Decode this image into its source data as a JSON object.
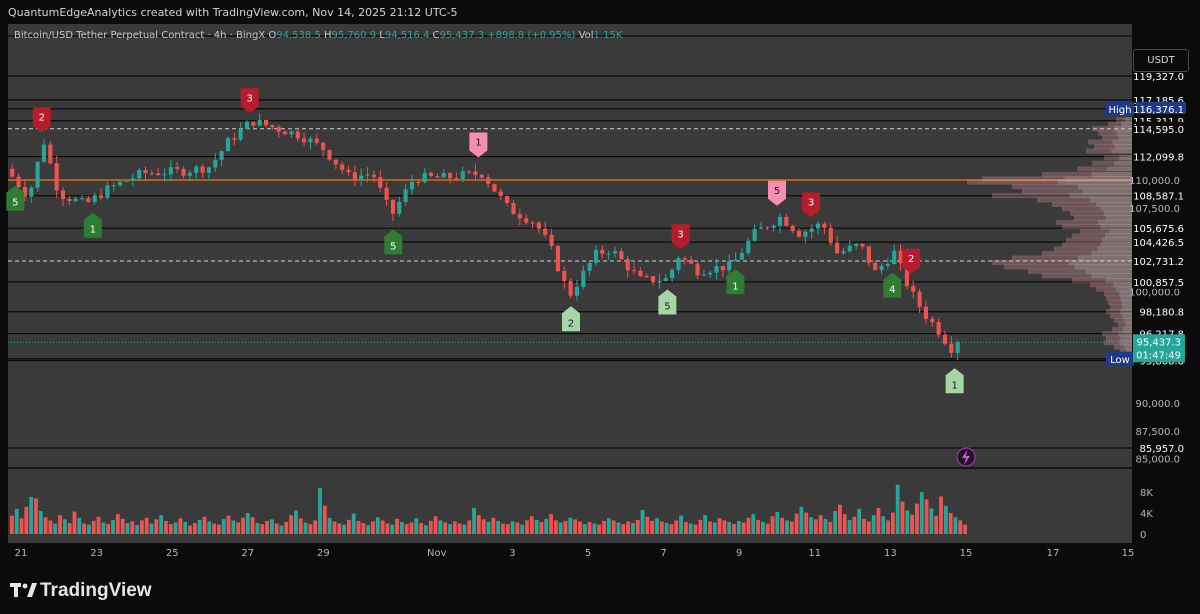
{
  "header": {
    "attribution": "QuantumEdgeAnalytics created with TradingView.com, Nov 14, 2025 21:12 UTC-5"
  },
  "legend": {
    "symbol": "Bitcoin/USD Tether Perpetual Contract · 4h · BingX",
    "o_label": "O",
    "o": "94,538.5",
    "h_label": "H",
    "h": "95,760.9",
    "l_label": "L",
    "l": "94,516.4",
    "c_label": "C",
    "c": "95,437.3",
    "change": "+898.8 (+0.95%)",
    "vol_label": "Vol",
    "vol": "1.15K"
  },
  "currency_button": "USDT",
  "footer": {
    "brand": "TradingView"
  },
  "colors": {
    "up": "#26a69a",
    "down": "#ef5350",
    "orange_line": "#f57c00",
    "bg_plot": "#3a3a3a",
    "page_bg": "#0b0b0b",
    "sell_marker": "#b71c2c",
    "sell_marker_light": "#f48fb1",
    "buy_marker": "#2e7d32",
    "buy_marker_light": "#a5d6a7"
  },
  "chart_data": {
    "type": "candlestick",
    "interval": "4h",
    "exchange": "BingX",
    "y_axis_ticks": [
      "110,000.0",
      "107,500.0",
      "100,000.0",
      "90,000.0",
      "87,500.0",
      "85,000.0"
    ],
    "price_levels": [
      {
        "label": "119,327.0",
        "value": 119327.0
      },
      {
        "label": "117,185.6",
        "value": 117185.6
      },
      {
        "label": "116,376.1",
        "value": 116376.1,
        "tag": "High"
      },
      {
        "label": "115,311.9",
        "value": 115311.9
      },
      {
        "label": "114,595.0",
        "value": 114595.0
      },
      {
        "label": "112,099.8",
        "value": 112099.8
      },
      {
        "label": "108,587.1",
        "value": 108587.1
      },
      {
        "label": "105,675.6",
        "value": 105675.6
      },
      {
        "label": "104,426.5",
        "value": 104426.5
      },
      {
        "label": "102,731.2",
        "value": 102731.2
      },
      {
        "label": "100,857.5",
        "value": 100857.5
      },
      {
        "label": "98,180.8",
        "value": 98180.8
      },
      {
        "label": "96,217.8",
        "value": 96217.8
      },
      {
        "label": "93,955.0",
        "value": 93955.0,
        "tag": "Low"
      },
      {
        "label": "93,808.8",
        "value": 93808.8
      },
      {
        "label": "85,957.0",
        "value": 85957.0
      }
    ],
    "current_price": {
      "label": "95,437.3",
      "countdown": "01:47:49",
      "value": 95437.3
    },
    "orange_level": 110000,
    "volume_ticks": [
      "8K",
      "4K",
      "0"
    ],
    "x_ticks": [
      {
        "label": "21",
        "day": 21
      },
      {
        "label": "23",
        "day": 23
      },
      {
        "label": "25",
        "day": 25
      },
      {
        "label": "27",
        "day": 27
      },
      {
        "label": "29",
        "day": 29
      },
      {
        "label": "Nov",
        "day": 32
      },
      {
        "label": "3",
        "day": 34
      },
      {
        "label": "5",
        "day": 36
      },
      {
        "label": "7",
        "day": 38
      },
      {
        "label": "9",
        "day": 40
      },
      {
        "label": "11",
        "day": 42
      },
      {
        "label": "13",
        "day": 44
      },
      {
        "label": "15",
        "day": 46
      },
      {
        "label": "17",
        "day": 48
      },
      {
        "label": "15",
        "day": 50
      }
    ],
    "anchors": [
      {
        "day": 20.6,
        "price": 111000
      },
      {
        "day": 21.2,
        "price": 108500
      },
      {
        "day": 21.6,
        "price": 113500
      },
      {
        "day": 22.0,
        "price": 108800
      },
      {
        "day": 22.7,
        "price": 107800
      },
      {
        "day": 23.3,
        "price": 109200
      },
      {
        "day": 24.2,
        "price": 110600
      },
      {
        "day": 25.3,
        "price": 110800
      },
      {
        "day": 26.0,
        "price": 111200
      },
      {
        "day": 26.5,
        "price": 113500
      },
      {
        "day": 27.1,
        "price": 115300
      },
      {
        "day": 27.8,
        "price": 114600
      },
      {
        "day": 28.4,
        "price": 114000
      },
      {
        "day": 29.0,
        "price": 112800
      },
      {
        "day": 29.7,
        "price": 110200
      },
      {
        "day": 30.3,
        "price": 110600
      },
      {
        "day": 30.8,
        "price": 106800
      },
      {
        "day": 31.4,
        "price": 110200
      },
      {
        "day": 32.2,
        "price": 110200
      },
      {
        "day": 33.2,
        "price": 110600
      },
      {
        "day": 33.9,
        "price": 107400
      },
      {
        "day": 34.6,
        "price": 106200
      },
      {
        "day": 35.0,
        "price": 104000
      },
      {
        "day": 35.5,
        "price": 99600
      },
      {
        "day": 36.2,
        "price": 103300
      },
      {
        "day": 36.6,
        "price": 103800
      },
      {
        "day": 37.4,
        "price": 101000
      },
      {
        "day": 38.1,
        "price": 101100
      },
      {
        "day": 38.4,
        "price": 103200
      },
      {
        "day": 38.9,
        "price": 101900
      },
      {
        "day": 39.8,
        "price": 102300
      },
      {
        "day": 40.4,
        "price": 105200
      },
      {
        "day": 41.1,
        "price": 106700
      },
      {
        "day": 41.6,
        "price": 105200
      },
      {
        "day": 42.2,
        "price": 106100
      },
      {
        "day": 42.6,
        "price": 103400
      },
      {
        "day": 43.2,
        "price": 104200
      },
      {
        "day": 43.6,
        "price": 101700
      },
      {
        "day": 44.1,
        "price": 103500
      },
      {
        "day": 44.5,
        "price": 100200
      },
      {
        "day": 44.9,
        "price": 98000
      },
      {
        "day": 45.3,
        "price": 96400
      },
      {
        "day": 45.6,
        "price": 94900
      },
      {
        "day": 45.78,
        "price": 95437
      }
    ],
    "volume_heights_k": [
      3.5,
      4.8,
      3.0,
      5.2,
      7.1,
      6.8,
      4.4,
      3.2,
      2.6,
      2.0,
      3.6,
      2.8,
      2.1,
      4.3,
      3.1,
      2.0,
      1.8,
      2.5,
      3.3,
      2.2,
      1.9,
      2.7,
      3.8,
      2.9,
      2.1,
      2.4,
      1.7,
      2.6,
      3.1,
      2.0,
      2.8,
      3.6,
      2.5,
      1.9,
      2.2,
      3.0,
      2.3,
      1.6,
      2.1,
      2.7,
      3.3,
      2.4,
      2.0,
      1.8,
      2.9,
      3.5,
      2.6,
      2.2,
      3.1,
      4.0,
      3.2,
      2.1,
      1.9,
      2.5,
      2.8,
      2.0,
      1.6,
      2.3,
      3.6,
      4.5,
      3.0,
      2.2,
      1.9,
      2.6,
      8.8,
      5.4,
      3.1,
      2.4,
      2.0,
      1.8,
      2.7,
      3.9,
      2.5,
      2.1,
      1.7,
      2.4,
      3.2,
      2.6,
      2.0,
      1.8,
      2.9,
      2.3,
      1.9,
      2.2,
      3.0,
      2.1,
      1.7,
      2.5,
      3.4,
      2.6,
      2.2,
      1.9,
      2.4,
      2.0,
      1.8,
      2.6,
      5.0,
      3.6,
      2.8,
      2.3,
      3.1,
      2.5,
      2.0,
      1.9,
      2.4,
      2.2,
      1.8,
      2.6,
      3.4,
      2.7,
      2.3,
      2.9,
      3.8,
      2.6,
      2.2,
      2.5,
      3.1,
      2.8,
      2.4,
      1.9,
      2.3,
      2.0,
      1.8,
      2.5,
      3.0,
      2.6,
      2.2,
      1.9,
      2.4,
      2.1,
      2.7,
      4.6,
      3.3,
      2.5,
      3.0,
      2.4,
      2.1,
      1.9,
      2.6,
      3.5,
      2.3,
      2.0,
      1.8,
      2.7,
      3.6,
      2.4,
      2.2,
      3.0,
      2.6,
      2.3,
      1.9,
      2.5,
      2.2,
      3.1,
      3.8,
      2.7,
      2.3,
      2.0,
      3.4,
      4.2,
      3.1,
      2.6,
      2.4,
      3.9,
      5.2,
      4.1,
      3.2,
      2.8,
      3.6,
      2.9,
      2.3,
      4.4,
      5.6,
      3.8,
      2.7,
      3.3,
      4.8,
      2.9,
      2.4,
      3.6,
      5.0,
      3.4,
      2.6,
      4.1,
      9.4,
      6.2,
      4.5,
      3.7,
      5.8,
      8.0,
      6.6,
      4.9,
      3.5,
      7.2,
      5.4,
      4.0,
      3.2,
      2.6,
      1.8
    ],
    "signals": [
      {
        "label": "2",
        "day": 21.55,
        "kind": "sell",
        "shade": "dark"
      },
      {
        "label": "5",
        "day": 20.85,
        "kind": "buy",
        "shade": "dark"
      },
      {
        "label": "1",
        "day": 22.9,
        "kind": "buy",
        "shade": "dark"
      },
      {
        "label": "3",
        "day": 27.05,
        "kind": "sell",
        "shade": "dark"
      },
      {
        "label": "5",
        "day": 30.85,
        "kind": "buy",
        "shade": "dark"
      },
      {
        "label": "1",
        "day": 33.1,
        "kind": "sell",
        "shade": "light"
      },
      {
        "label": "2",
        "day": 35.55,
        "kind": "buy",
        "shade": "light"
      },
      {
        "label": "5",
        "day": 38.1,
        "kind": "buy",
        "shade": "light"
      },
      {
        "label": "3",
        "day": 38.45,
        "kind": "sell",
        "shade": "dark"
      },
      {
        "label": "1",
        "day": 39.9,
        "kind": "buy",
        "shade": "dark"
      },
      {
        "label": "5",
        "day": 41.0,
        "kind": "sell",
        "shade": "light"
      },
      {
        "label": "3",
        "day": 41.9,
        "kind": "sell",
        "shade": "dark"
      },
      {
        "label": "4",
        "day": 44.05,
        "kind": "buy",
        "shade": "dark"
      },
      {
        "label": "2",
        "day": 44.55,
        "kind": "sell",
        "shade": "dark"
      },
      {
        "label": "1",
        "day": 45.7,
        "kind": "buy",
        "shade": "light"
      }
    ]
  }
}
